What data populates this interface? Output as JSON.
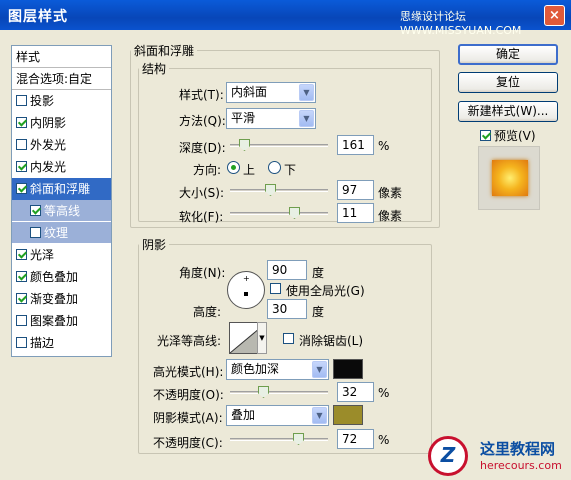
{
  "window": {
    "title": "图层样式",
    "watermark": "思缘设计论坛 WWW.MISSYUAN.COM",
    "close_label": "×"
  },
  "sidebar": {
    "header": "样式",
    "blend_label": "混合选项:自定",
    "items": [
      {
        "label": "投影",
        "checked": false
      },
      {
        "label": "内阴影",
        "checked": true
      },
      {
        "label": "外发光",
        "checked": false
      },
      {
        "label": "内发光",
        "checked": true
      },
      {
        "label": "斜面和浮雕",
        "checked": true,
        "selected": true
      },
      {
        "label": "等高线",
        "checked": true,
        "sub": true
      },
      {
        "label": "纹理",
        "checked": false,
        "sub": true
      },
      {
        "label": "光泽",
        "checked": true
      },
      {
        "label": "颜色叠加",
        "checked": true
      },
      {
        "label": "渐变叠加",
        "checked": true
      },
      {
        "label": "图案叠加",
        "checked": false
      },
      {
        "label": "描边",
        "checked": false
      }
    ]
  },
  "bevel": {
    "section_title": "斜面和浮雕",
    "structure_title": "结构",
    "style_label": "样式(T):",
    "style_value": "内斜面",
    "technique_label": "方法(Q):",
    "technique_value": "平滑",
    "depth_label": "深度(D):",
    "depth_value": "161",
    "depth_unit": "%",
    "depth_pos": 0.1,
    "direction_label": "方向:",
    "direction_up": "上",
    "direction_down": "下",
    "size_label": "大小(S):",
    "size_value": "97",
    "size_unit": "像素",
    "size_pos": 0.4,
    "soften_label": "软化(F):",
    "soften_value": "11",
    "soften_unit": "像素",
    "soften_pos": 0.68
  },
  "shading": {
    "title": "阴影",
    "angle_label": "角度(N):",
    "angle_value": "90",
    "angle_unit": "度",
    "global_light_label": "使用全局光(G)",
    "altitude_label": "高度:",
    "altitude_value": "30",
    "altitude_unit": "度",
    "gloss_label": "光泽等高线:",
    "antialias_label": "消除锯齿(L)",
    "highlight_mode_label": "高光模式(H):",
    "highlight_mode_value": "颜色加深",
    "highlight_color": "#0a0a0a",
    "highlight_opacity_label": "不透明度(O):",
    "highlight_opacity_value": "32",
    "highlight_opacity_unit": "%",
    "highlight_opacity_pos": 0.32,
    "shadow_mode_label": "阴影模式(A):",
    "shadow_mode_value": "叠加",
    "shadow_color": "#9b8c2a",
    "shadow_opacity_label": "不透明度(C):",
    "shadow_opacity_value": "72",
    "shadow_opacity_unit": "%",
    "shadow_opacity_pos": 0.72
  },
  "buttons": {
    "ok": "确定",
    "reset": "复位",
    "new_style": "新建样式(W)...",
    "preview_label": "预览(V)"
  },
  "logo": {
    "letter": "Z",
    "name": "这里教程网",
    "url": "herecours.com"
  }
}
